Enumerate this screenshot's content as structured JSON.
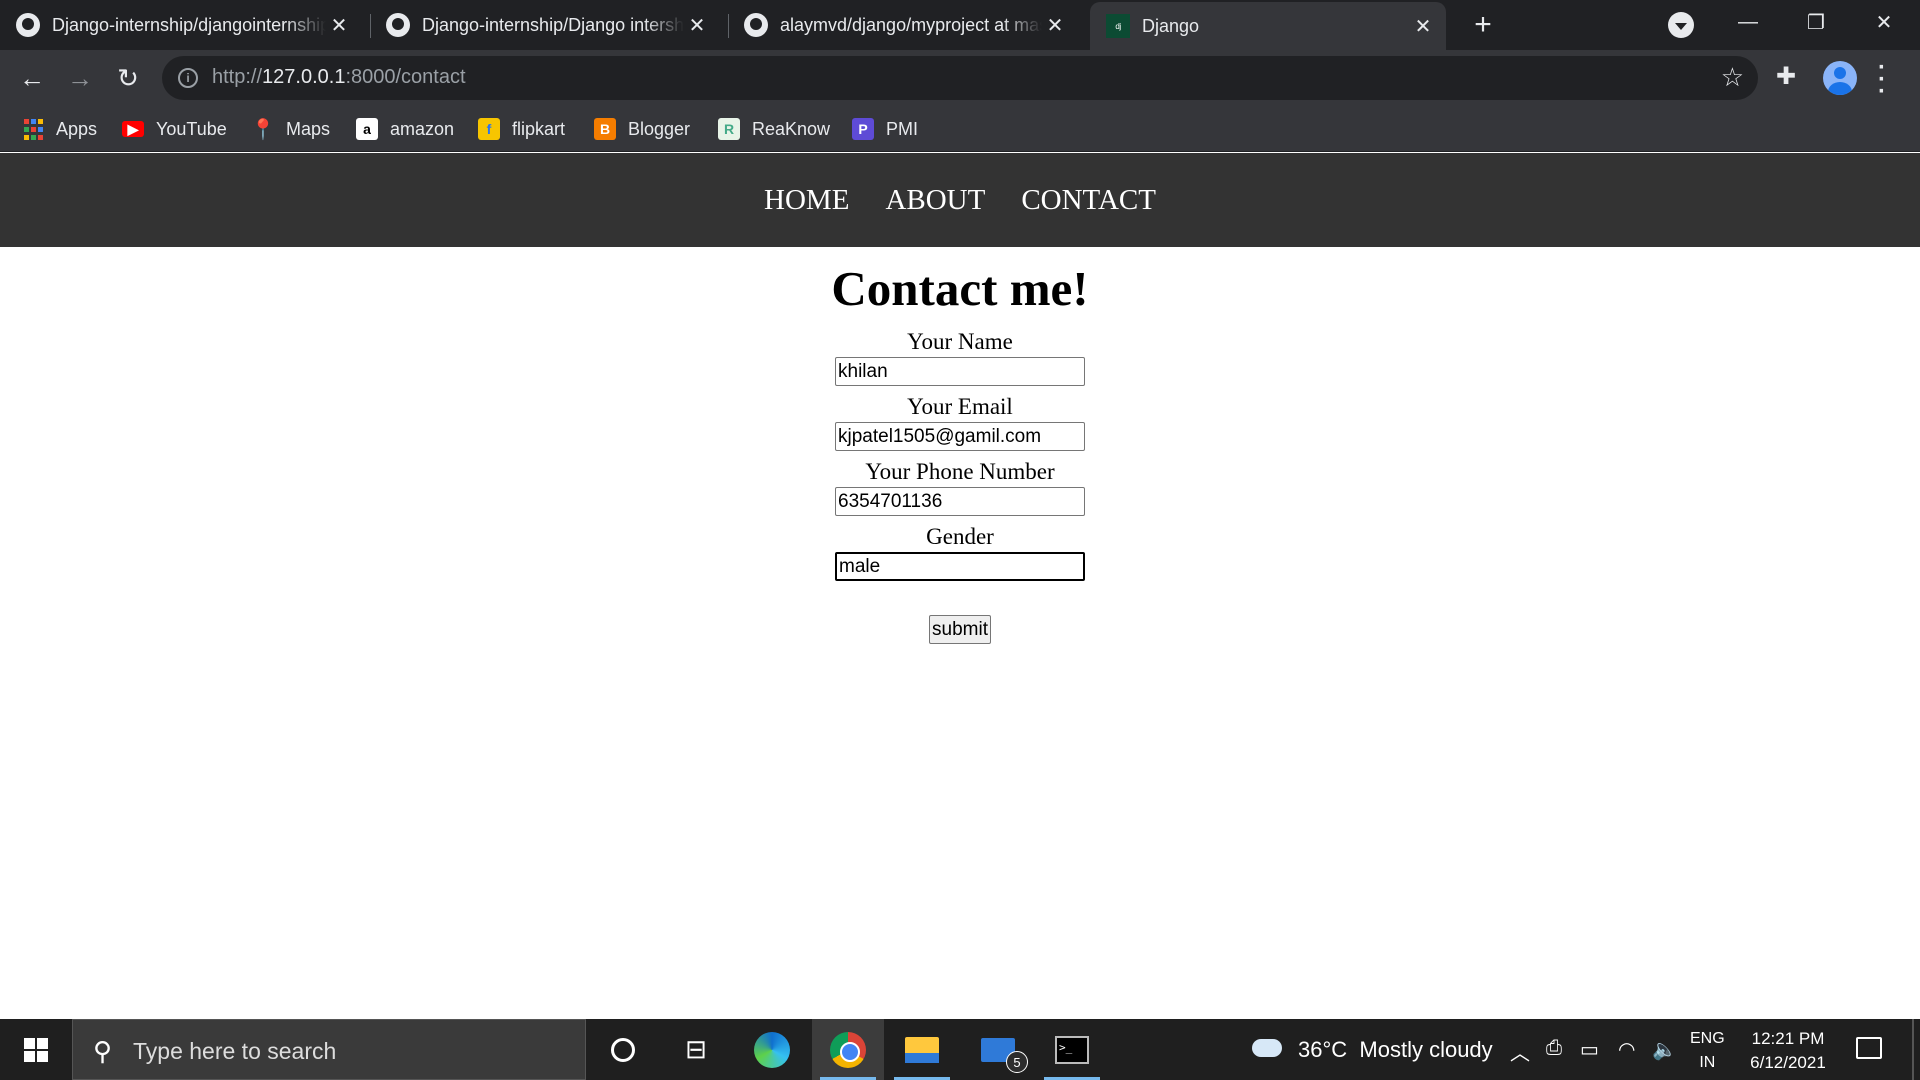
{
  "browser": {
    "tabs": [
      {
        "title": "Django-internship/djangointernship",
        "icon": "github-icon"
      },
      {
        "title": "Django-internship/Django intership",
        "icon": "github-icon"
      },
      {
        "title": "alaymvd/django/myproject at master",
        "icon": "github-icon"
      },
      {
        "title": "Django",
        "icon": "django-icon",
        "active": true
      }
    ],
    "new_tab_label": "+",
    "url_prefix": "http://",
    "url_host": "127.0.0.1",
    "url_path": ":8000/contact",
    "bookmarks": [
      {
        "label": "Apps",
        "icon": "apps-grid-icon"
      },
      {
        "label": "YouTube",
        "icon": "youtube-icon",
        "color": "#ff0000"
      },
      {
        "label": "Maps",
        "icon": "maps-icon",
        "color": "#34a853"
      },
      {
        "label": "amazon",
        "icon": "amazon-icon",
        "color": "#ffffff"
      },
      {
        "label": "flipkart",
        "icon": "flipkart-icon",
        "color": "#f7c500"
      },
      {
        "label": "Blogger",
        "icon": "blogger-icon",
        "color": "#f57d00"
      },
      {
        "label": "ReaKnow",
        "icon": "reaknow-icon",
        "color": "#e8f4e8"
      },
      {
        "label": "PMI",
        "icon": "pmi-icon",
        "color": "#5e4bd6"
      }
    ]
  },
  "site": {
    "nav": [
      "HOME",
      "ABOUT",
      "CONTACT"
    ],
    "nav_bg": "#333333",
    "heading": "Contact me!",
    "form": {
      "name_label": "Your Name",
      "name_value": "khilan",
      "email_label": "Your Email",
      "email_value": "kjpatel1505@gamil.com",
      "phone_label": "Your Phone Number",
      "phone_value": "6354701136",
      "gender_label": "Gender",
      "gender_value": "male",
      "submit_label": "submit"
    }
  },
  "taskbar": {
    "search_placeholder": "Type here to search",
    "mail_badge": "5",
    "weather_temp": "36°C",
    "weather_desc": "Mostly cloudy",
    "lang_line1": "ENG",
    "lang_line2": "IN",
    "time": "12:21 PM",
    "date": "6/12/2021"
  }
}
